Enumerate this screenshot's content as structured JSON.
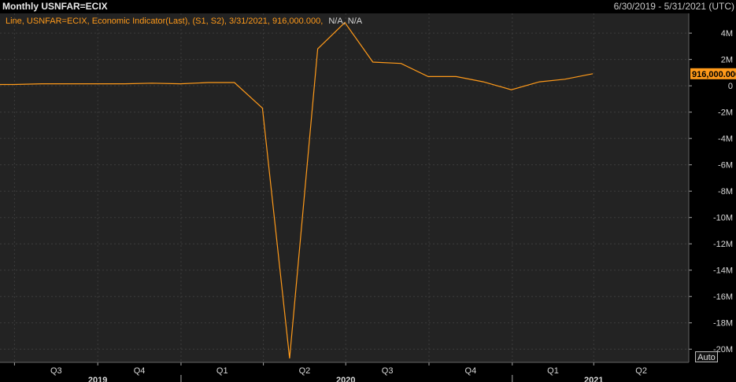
{
  "header": {
    "title": "Monthly USNFAR=ECIX",
    "date_range": "6/30/2019 - 5/31/2021 (UTC)"
  },
  "legend": {
    "prefix": "Line, USNFAR=ECIX, Economic Indicator(Last), (S1, S2), 3/31/2021, 916,000.000,",
    "suffix": "N/A, N/A"
  },
  "last_value_label": "916,000.000",
  "auto_button": "Auto",
  "colors": {
    "background": "#232323",
    "grid": "#3c3c3c",
    "line": "#ff9a1a",
    "legend_text": "#ff9a1a",
    "last_value_badge": "#ff9a1a"
  },
  "chart_data": {
    "type": "line",
    "title": "Monthly USNFAR=ECIX",
    "xlabel": "",
    "ylabel": "",
    "ylim": [
      -21000000,
      5500000
    ],
    "xlim": [
      "2019-06-15",
      "2021-07-15"
    ],
    "y_ticks": [
      4000000,
      2000000,
      0,
      -2000000,
      -4000000,
      -6000000,
      -8000000,
      -10000000,
      -12000000,
      -14000000,
      -16000000,
      -18000000,
      -20000000
    ],
    "y_tick_labels": [
      "4M",
      "2M",
      "0",
      "-2M",
      "-4M",
      "-6M",
      "-8M",
      "-10M",
      "-12M",
      "-14M",
      "-16M",
      "-18M",
      "-20M"
    ],
    "x_quarter_ticks": [
      {
        "date": "2019-07-01",
        "label": "Q3"
      },
      {
        "date": "2019-10-01",
        "label": "Q4"
      },
      {
        "date": "2020-01-01",
        "label": "Q1"
      },
      {
        "date": "2020-04-01",
        "label": "Q2"
      },
      {
        "date": "2020-07-01",
        "label": "Q3"
      },
      {
        "date": "2020-10-01",
        "label": "Q4"
      },
      {
        "date": "2021-01-01",
        "label": "Q1"
      },
      {
        "date": "2021-04-01",
        "label": "Q2"
      }
    ],
    "x_year_labels": [
      {
        "date": "2019-10-01",
        "label": "2019"
      },
      {
        "date": "2020-07-01",
        "label": "2020"
      },
      {
        "date": "2021-04-01",
        "label": "2021"
      }
    ],
    "year_boundaries": [
      "2020-01-01",
      "2021-01-01"
    ],
    "grid": true,
    "series": [
      {
        "name": "USNFAR=ECIX",
        "x": [
          "2019-06-30",
          "2019-07-31",
          "2019-08-31",
          "2019-09-30",
          "2019-10-31",
          "2019-11-30",
          "2019-12-31",
          "2020-01-31",
          "2020-02-29",
          "2020-03-31",
          "2020-04-30",
          "2020-05-31",
          "2020-06-30",
          "2020-07-31",
          "2020-08-31",
          "2020-09-30",
          "2020-10-31",
          "2020-11-30",
          "2020-12-31",
          "2021-01-31",
          "2021-02-28",
          "2021-03-31"
        ],
        "y": [
          100000,
          150000,
          150000,
          150000,
          150000,
          200000,
          150000,
          250000,
          250000,
          -1700000,
          -20700000,
          2800000,
          4800000,
          1800000,
          1700000,
          700000,
          700000,
          300000,
          -300000,
          300000,
          500000,
          916000
        ]
      }
    ]
  }
}
